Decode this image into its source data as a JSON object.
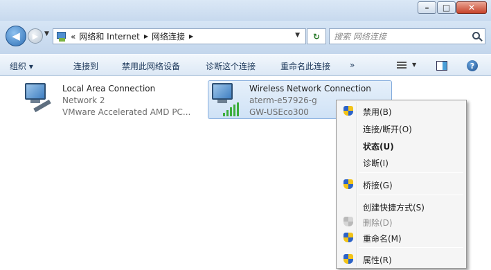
{
  "window": {
    "minimize_icon": "minimize-icon",
    "maximize_icon": "maximize-icon",
    "close_icon": "close-icon"
  },
  "nav": {
    "breadcrumb_prefix": "«",
    "crumbs": [
      "网络和 Internet",
      "网络连接"
    ],
    "refresh_icon": "refresh-icon",
    "search_placeholder": "搜索 网络连接"
  },
  "toolbar": {
    "organize": "组织 ▾",
    "connect_to": "连接到",
    "disable_device": "禁用此网络设备",
    "diagnose": "诊断这个连接",
    "rename": "重命名此连接",
    "more": "»"
  },
  "connections": [
    {
      "name": "Local Area Connection",
      "line2": "Network  2",
      "line3": "VMware Accelerated AMD PC..."
    },
    {
      "name": "Wireless Network Connection",
      "line2": "aterm-e57926-g",
      "line3": "GW-USEco300"
    }
  ],
  "context_menu": {
    "items": [
      {
        "label": "禁用(B)",
        "icon": "uac-shield-icon"
      },
      {
        "label": "连接/断开(O)"
      },
      {
        "label": "状态(U)",
        "bold": true
      },
      {
        "label": "诊断(I)"
      },
      {
        "label": "桥接(G)",
        "icon": "uac-shield-icon"
      },
      {
        "label": "创建快捷方式(S)"
      },
      {
        "label": "删除(D)",
        "icon": "uac-shield-icon",
        "disabled": true
      },
      {
        "label": "重命名(M)",
        "icon": "uac-shield-icon"
      },
      {
        "label": "属性(R)",
        "icon": "uac-shield-icon"
      }
    ]
  },
  "colors": {
    "accent": "#1e395b",
    "selection": "#cfe2f6",
    "signal": "#3cae3c"
  }
}
